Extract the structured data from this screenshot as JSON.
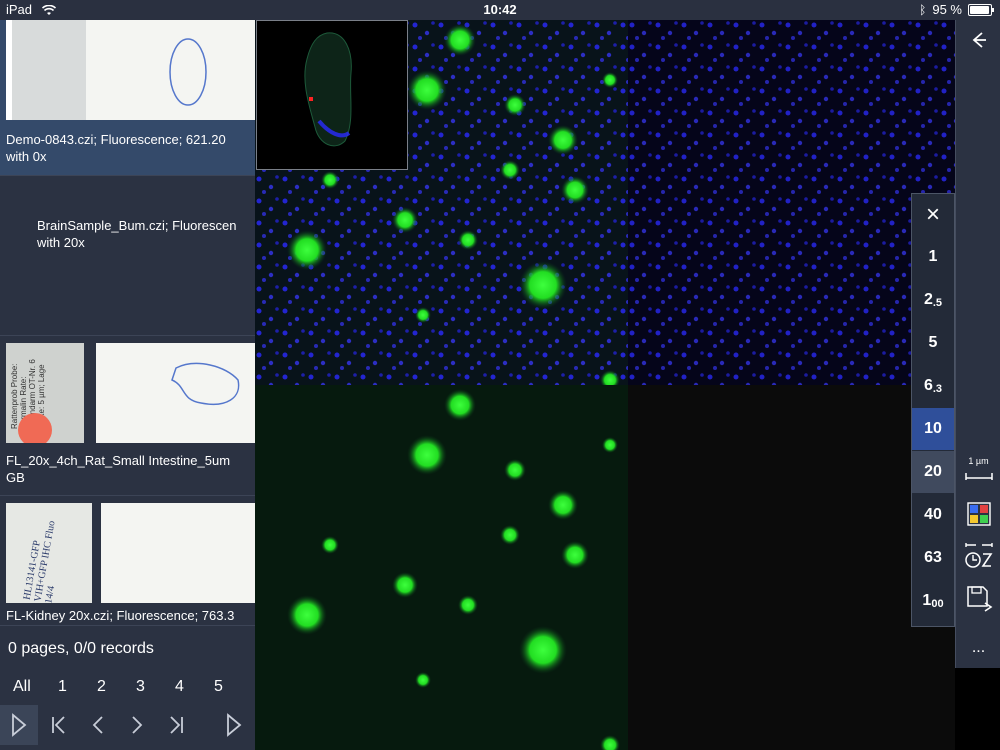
{
  "status_bar": {
    "device": "iPad",
    "time": "10:42",
    "battery": "95 %",
    "battery_level": 0.95
  },
  "slides": [
    {
      "label": "Demo-0843.czi; Fluorescence; 621.20\nwith 0x",
      "selected": true
    },
    {
      "label": "BrainSample_Bum.czi; Fluorescen\nwith 20x",
      "selected": false
    },
    {
      "label": "FL_20x_4ch_Rat_Small Intestine_5um\nGB",
      "selected": false,
      "slide_text": "Rattenprob Probe: Formalin Rate: Dünndarm OT-Nr. 6 Dicke: 5 µm; Lage"
    },
    {
      "label": "FL-Kidney 20x.czi; Fluorescence; 763.3",
      "selected": false,
      "slide_text": "HL13141-GFP VIH+GFP IHC Fluo 14/4"
    }
  ],
  "list_status": "0 pages, 0/0 records",
  "pager": {
    "all": "All",
    "pages": [
      "1",
      "2",
      "3",
      "4",
      "5"
    ]
  },
  "nav": {
    "play": "play-icon",
    "first": "first-page-icon",
    "prev": "prev-icon",
    "next": "next-icon",
    "last": "last-page-icon",
    "more": "play-icon"
  },
  "zoom": {
    "close": "×",
    "levels": [
      {
        "main": "1",
        "small": ""
      },
      {
        "main": "2",
        "small": ".5"
      },
      {
        "main": "5",
        "small": ""
      },
      {
        "main": "6",
        "small": ".3"
      },
      {
        "main": "10",
        "small": ""
      },
      {
        "main": "20",
        "small": ""
      },
      {
        "main": "40",
        "small": ""
      },
      {
        "main": "63",
        "small": ""
      },
      {
        "main": "1",
        "small": "00"
      }
    ],
    "active_level": "10",
    "hover_level": "20"
  },
  "toolbar": {
    "scale_label": "1 µm",
    "more": "..."
  },
  "colors": {
    "sidebar": "#2b3242",
    "selected": "#344a6a",
    "accent": "#2f4f9a",
    "fluorescence_green": "#22ee22",
    "nuclei_blue": "#2a2aff"
  }
}
